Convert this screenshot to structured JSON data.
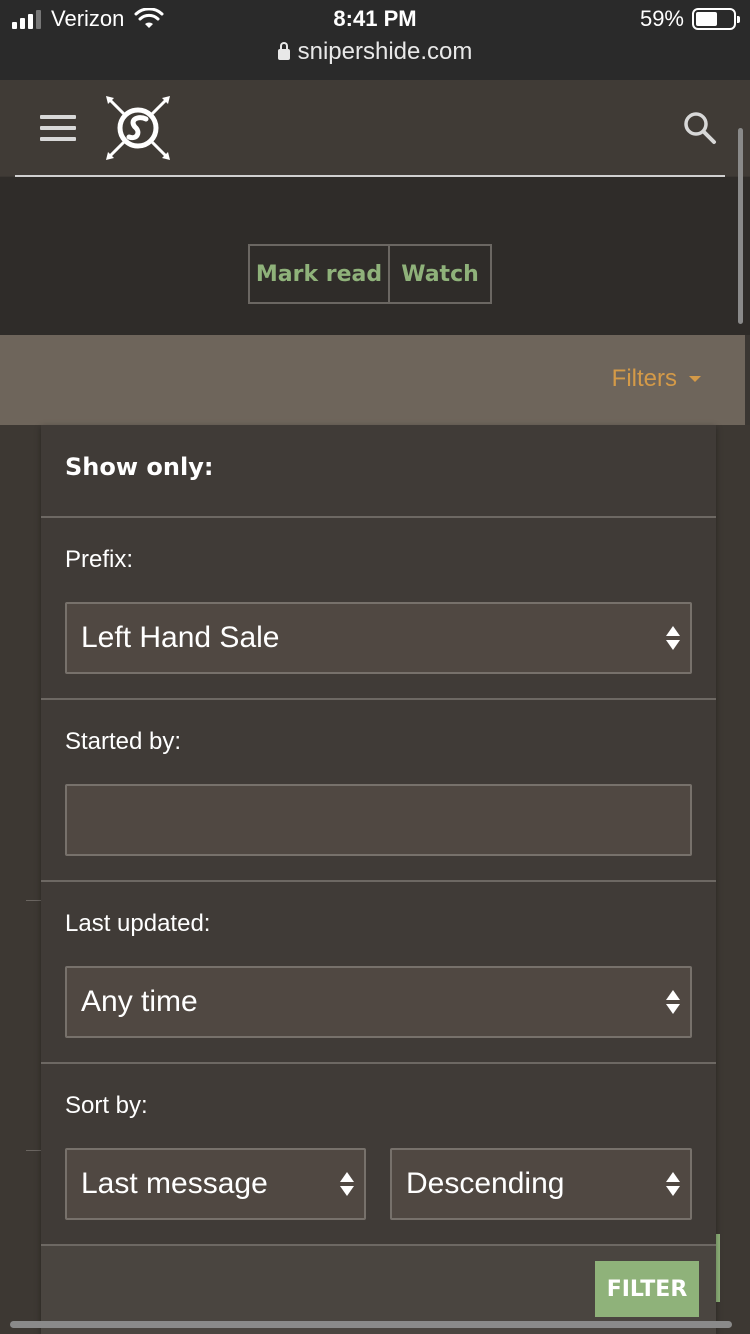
{
  "status_bar": {
    "carrier": "Verizon",
    "time": "8:41 PM",
    "battery_percent": "59%",
    "battery_level": 0.59,
    "url": "snipershide.com"
  },
  "header": {
    "menu_icon": "hamburger-icon",
    "logo_icon": "snipers-hide-logo",
    "search_icon": "search-icon"
  },
  "actions": {
    "mark_read": "Mark read",
    "watch": "Watch"
  },
  "filter_bar": {
    "toggle_label": "Filters"
  },
  "filter_menu": {
    "title": "Show only:",
    "prefix": {
      "label": "Prefix:",
      "value": "Left Hand Sale"
    },
    "started_by": {
      "label": "Started by:",
      "value": ""
    },
    "last_updated": {
      "label": "Last updated:",
      "value": "Any time"
    },
    "sort": {
      "label": "Sort by:",
      "field": "Last message",
      "direction": "Descending"
    },
    "submit": "FILTER"
  },
  "colors": {
    "accent_green": "#8fb27a",
    "accent_orange": "#d49a48",
    "panel": "#403b37",
    "field": "#504842"
  }
}
